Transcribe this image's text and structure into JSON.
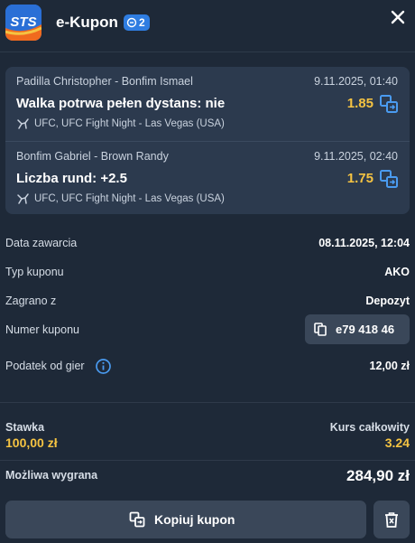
{
  "header": {
    "logo_text": "STS",
    "title": "e-Kupon",
    "bet_count": "2"
  },
  "bets": [
    {
      "teams": "Padilla Christopher - Bonfim Ismael",
      "date": "9.11.2025, 01:40",
      "pick": "Walka potrwa pełen dystans: nie",
      "odds": "1.85",
      "event": "UFC, UFC Fight Night - Las Vegas (USA)"
    },
    {
      "teams": "Bonfim Gabriel - Brown Randy",
      "date": "9.11.2025, 02:40",
      "pick": "Liczba rund: +2.5",
      "odds": "1.75",
      "event": "UFC, UFC Fight Night - Las Vegas (USA)"
    }
  ],
  "details": {
    "date_label": "Data zawarcia",
    "date_value": "08.11.2025, 12:04",
    "type_label": "Typ kuponu",
    "type_value": "AKO",
    "source_label": "Zagrano z",
    "source_value": "Depozyt",
    "number_label": "Numer kuponu",
    "number_value": "e79 418 46",
    "tax_label": "Podatek od gier",
    "tax_value": "12,00 zł"
  },
  "summary": {
    "stake_label": "Stawka",
    "stake_value": "100,00 zł",
    "total_odds_label": "Kurs całkowity",
    "total_odds_value": "3.24",
    "win_label": "Możliwa wygrana",
    "win_value": "284,90 zł"
  },
  "actions": {
    "copy_label": "Kopiuj kupon"
  },
  "colors": {
    "background": "#1e2938",
    "panel": "#2c3a4e",
    "accent": "#2f7de1",
    "odds": "#f5c342",
    "button": "#3a4759"
  },
  "icons": [
    "sts-logo-icon",
    "ticket-icon",
    "close-icon",
    "swap-icon",
    "ufc-icon",
    "copy-icon",
    "info-icon",
    "trash-icon"
  ]
}
